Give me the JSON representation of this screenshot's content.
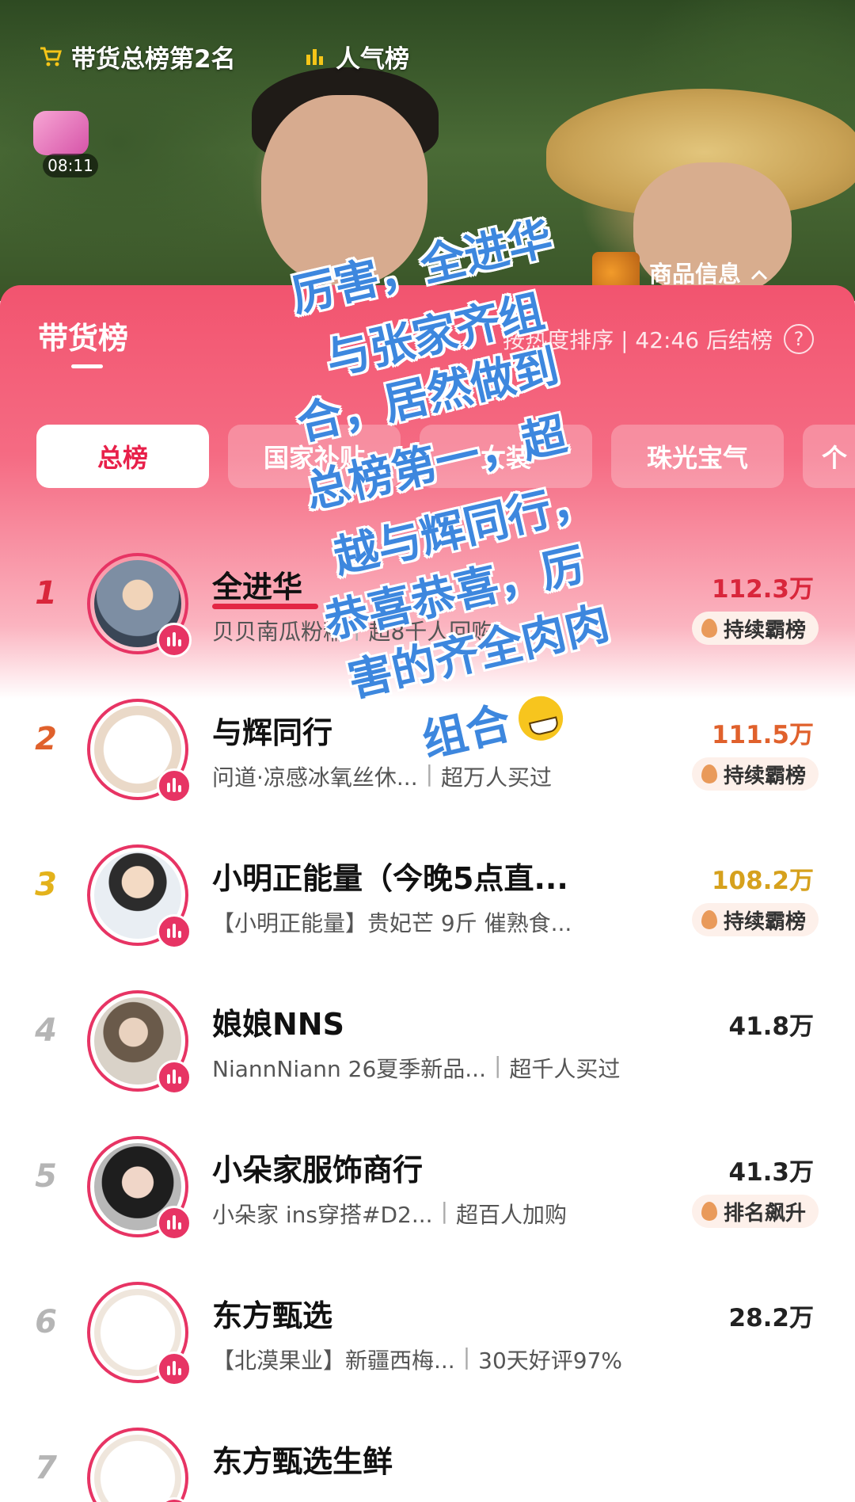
{
  "header": {
    "sales_rank_chip": "带货总榜第2名",
    "popularity_chip": "人气榜",
    "timer": "08:11",
    "product_info": "商品信息"
  },
  "board": {
    "title": "带货榜",
    "meta": "按热度排序 | 42:46 后结榜",
    "help": "?",
    "tabs": [
      "总榜",
      "国家补贴",
      "女装",
      "珠光宝气",
      "个"
    ]
  },
  "entries": [
    {
      "rank": "1",
      "name": "全进华",
      "desc": "贝贝南瓜粉糯",
      "extra": "超8千人回购",
      "value": "112.3万",
      "tag": "持续霸榜"
    },
    {
      "rank": "2",
      "name": "与辉同行",
      "desc": "问道·凉感冰氧丝休...",
      "extra": "超万人买过",
      "value": "111.5万",
      "tag": "持续霸榜"
    },
    {
      "rank": "3",
      "name": "小明正能量（今晚5点直...",
      "desc": "【小明正能量】贵妃芒 9斤 催熟食...",
      "extra": "",
      "value": "108.2万",
      "tag": "持续霸榜"
    },
    {
      "rank": "4",
      "name": "娘娘NNS",
      "desc": "NiannNiann 26夏季新品...",
      "extra": "超千人买过",
      "value": "41.8万",
      "tag": ""
    },
    {
      "rank": "5",
      "name": "小朵家服饰商行",
      "desc": "小朵家 ins穿搭#D2...",
      "extra": "超百人加购",
      "value": "41.3万",
      "tag": "排名飙升"
    },
    {
      "rank": "6",
      "name": "东方甄选",
      "desc": "【北漠果业】新疆西梅...",
      "extra": "30天好评97%",
      "value": "28.2万",
      "tag": ""
    },
    {
      "rank": "7",
      "name": "东方甄选生鲜",
      "desc": "",
      "extra": "",
      "value": "",
      "tag": ""
    }
  ],
  "overlay_caption": [
    "厉害，全进华",
    "与张家齐组",
    "合，居然做到",
    "总榜第一，超",
    "越与辉同行，",
    "恭喜恭喜，厉",
    "害的齐全肉肉",
    "组合"
  ],
  "colors": {
    "accent": "#e73464",
    "rank1": "#d9263b",
    "rank2": "#e0612c",
    "rank3": "#e3b21b",
    "rank_other": "#b5b5b5",
    "value1": "#d9263b",
    "value2": "#e0612c",
    "value3": "#d6a11d",
    "value_other": "#222222",
    "caption": "#3d87de"
  }
}
